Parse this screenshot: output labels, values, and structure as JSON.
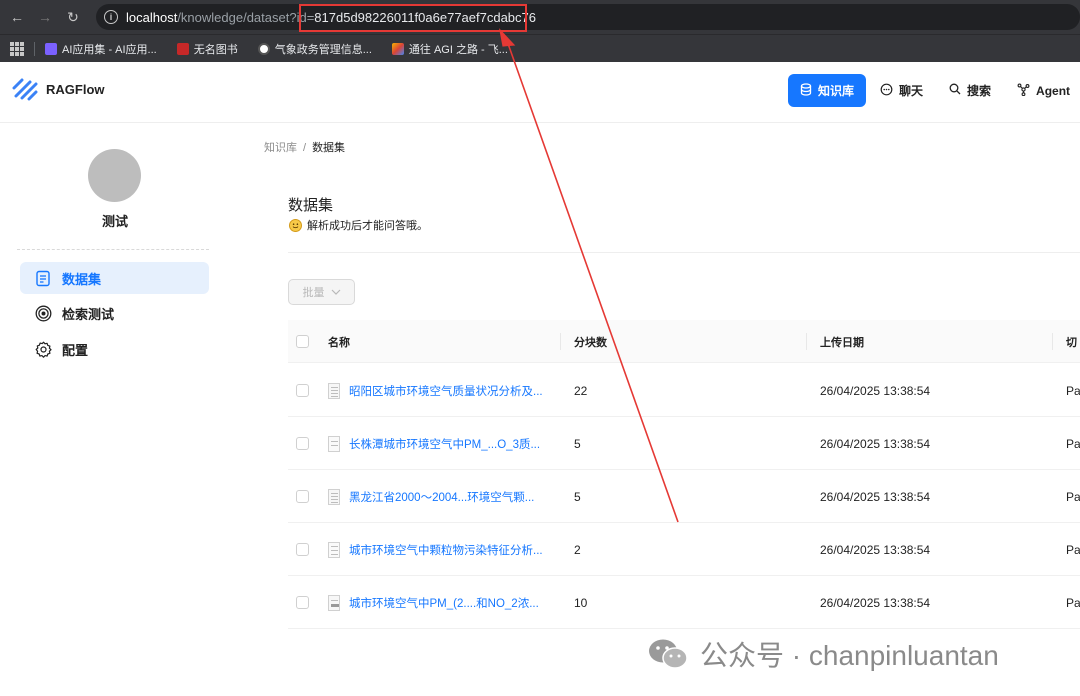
{
  "browser": {
    "url_host": "localhost",
    "url_path": "/knowledge/dataset?",
    "url_param": "id=",
    "url_id": "817d5d98226011f0a6e77aef7cdabc76",
    "bookmarks": [
      {
        "label": "AI应用集 - AI应用...",
        "color": "#7b61ff"
      },
      {
        "label": "无名图书",
        "color": "#c62828"
      },
      {
        "label": "气象政务管理信息...",
        "color": "#e8eaed"
      },
      {
        "label": "通往 AGI 之路 - 飞...",
        "color": "#f4b400"
      }
    ]
  },
  "app": {
    "name": "RAGFlow",
    "nav": [
      {
        "label": "知识库",
        "icon": "database-icon",
        "active": true
      },
      {
        "label": "聊天",
        "icon": "chat-icon",
        "active": false
      },
      {
        "label": "搜索",
        "icon": "search-icon",
        "active": false
      },
      {
        "label": "Agent",
        "icon": "agent-icon",
        "active": false
      }
    ]
  },
  "sidebar": {
    "kb_name": "测试",
    "items": [
      {
        "label": "数据集",
        "icon": "file-text-icon",
        "active": true
      },
      {
        "label": "检索测试",
        "icon": "target-icon",
        "active": false
      },
      {
        "label": "配置",
        "icon": "gear-icon",
        "active": false
      }
    ]
  },
  "breadcrumb": {
    "root": "知识库",
    "sep": "/",
    "current": "数据集"
  },
  "main": {
    "title": "数据集",
    "subtitle": "解析成功后才能问答哦。",
    "batch_label": "批量"
  },
  "table": {
    "headers": [
      "名称",
      "分块数",
      "上传日期",
      "切片"
    ],
    "header_last_visible": "切",
    "rows": [
      {
        "name": "昭阳区城市环境空气质量状况分析及...",
        "chunks": "22",
        "date": "26/04/2025 13:38:54",
        "method": "Pa"
      },
      {
        "name": "长株潭城市环境空气中PM_...O_3质...",
        "chunks": "5",
        "date": "26/04/2025 13:38:54",
        "method": "Pa"
      },
      {
        "name": "黑龙江省2000～2004...环境空气颗...",
        "chunks": "5",
        "date": "26/04/2025 13:38:54",
        "method": "Pa"
      },
      {
        "name": "城市环境空气中颗粒物污染特征分析...",
        "chunks": "2",
        "date": "26/04/2025 13:38:54",
        "method": "Pa"
      },
      {
        "name": "城市环境空气中PM_(2....和NO_2浓...",
        "chunks": "10",
        "date": "26/04/2025 13:38:54",
        "method": "Pa"
      }
    ]
  },
  "watermark": {
    "text": "公众号 · chanpinluantan"
  },
  "colors": {
    "accent": "#1677ff",
    "annotation": "#e53935"
  }
}
